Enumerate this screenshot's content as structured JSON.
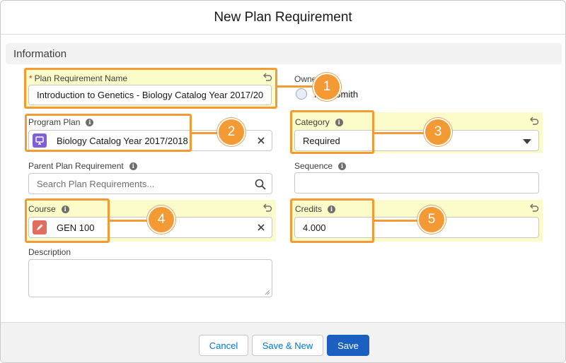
{
  "modal": {
    "title": "New Plan Requirement"
  },
  "section": {
    "title": "Information"
  },
  "fields": {
    "plan_requirement_name": {
      "required_marker": "*",
      "label": "Plan Requirement Name",
      "value": "Introduction to Genetics - Biology Catalog Year 2017/20"
    },
    "owner": {
      "label": "Owner",
      "value": "Nick Smith"
    },
    "program_plan": {
      "label": "Program Plan",
      "value": "Biology Catalog Year 2017/2018"
    },
    "category": {
      "label": "Category",
      "value": "Required"
    },
    "parent_plan_requirement": {
      "label": "Parent Plan Requirement",
      "placeholder": "Search Plan Requirements..."
    },
    "sequence": {
      "label": "Sequence",
      "value": ""
    },
    "course": {
      "label": "Course",
      "value": "GEN 100"
    },
    "credits": {
      "label": "Credits",
      "value": "4.000"
    },
    "description": {
      "label": "Description",
      "value": ""
    }
  },
  "callouts": [
    "1",
    "2",
    "3",
    "4",
    "5"
  ],
  "footer": {
    "cancel_label": "Cancel",
    "save_new_label": "Save & New",
    "save_label": "Save"
  },
  "colors": {
    "accent": "#f39a35",
    "highlight": "#fafbc8",
    "brand_button": "#1b5fc1",
    "program_plan_icon": "#7f5fd6",
    "course_icon": "#e16d5c"
  }
}
